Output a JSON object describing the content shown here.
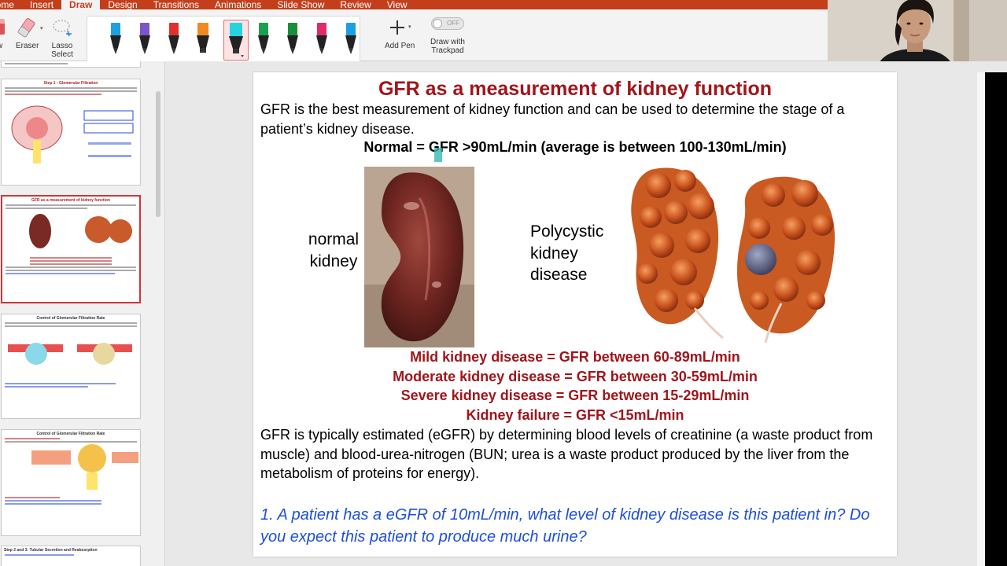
{
  "ribbon": {
    "tabs": [
      "Home",
      "Insert",
      "Draw",
      "Design",
      "Transitions",
      "Animations",
      "Slide Show",
      "Review",
      "View"
    ],
    "active_tab": "Draw",
    "eraser_label": "Eraser",
    "lasso_label": "Lasso Select",
    "add_pen_label": "Add Pen",
    "trackpad_label": "Draw with Trackpad",
    "trackpad_state": "OFF",
    "pen_colors": [
      "#1ea0e0",
      "#7a55c8",
      "#e0302a",
      "#f08a20",
      "#26d4e0",
      "#1aa050",
      "#1a8f3a",
      "#e02a6a",
      "#1aa0e0"
    ]
  },
  "slide": {
    "title": "GFR as a measurement of kidney function",
    "intro": "GFR is the best measurement of kidney function and can be used to determine the stage of a patient’s kidney disease.",
    "normal_line": "Normal = GFR >90mL/min (average is between 100-130mL/min)",
    "normal_kidney_label": "normal kidney",
    "pkd_label": "Polycystic kidney disease",
    "stages": [
      "Mild kidney disease = GFR between 60-89mL/min",
      "Moderate kidney disease = GFR between 30-59mL/min",
      "Severe kidney disease = GFR between 15-29mL/min",
      "Kidney failure = GFR <15mL/min"
    ],
    "egfr_text": "GFR is typically estimated (eGFR) by determining blood levels of creatinine (a waste product from muscle) and blood-urea-nitrogen (BUN; urea is a waste product produced by the liver from the metabolism of proteins for energy).",
    "question": "1. A patient has a eGFR of 10mL/min, what level of kidney disease is this patient in?  Do you expect this patient to produce much urine?"
  },
  "thumbnails": {
    "step1_title": "Step 1 - Glomerular Filtration",
    "gfr_title": "GFR as a measurement of kidney function",
    "control_title": "Control of Glomerular Filtration Rate",
    "control2_title": "Control of Glomerular Filtration Rate",
    "step23_title": "Step 2 and 3: Tubular Secretion and Reabsorption"
  }
}
